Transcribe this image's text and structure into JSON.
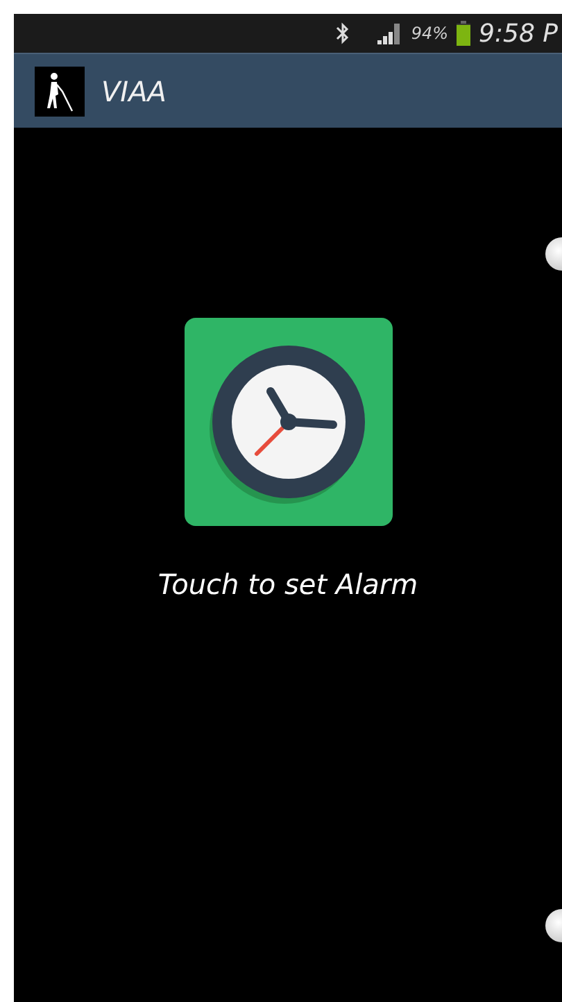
{
  "status_bar": {
    "battery": "94%",
    "time": "9:58 P"
  },
  "app_bar": {
    "title": "VIAA"
  },
  "main": {
    "caption": "Touch to set Alarm"
  }
}
